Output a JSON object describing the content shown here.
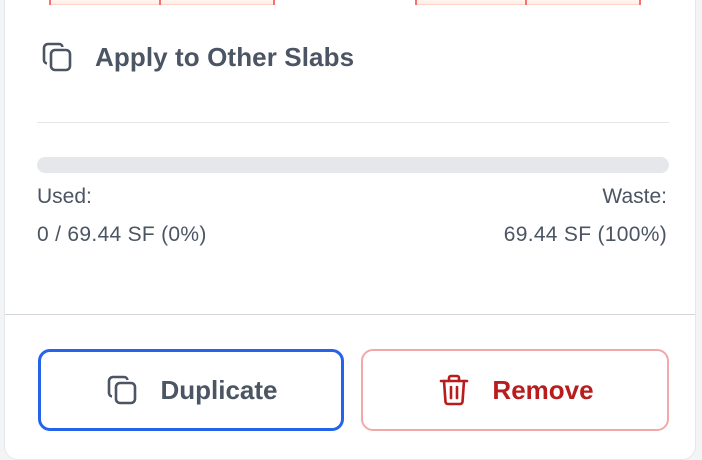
{
  "apply": {
    "label": "Apply to Other Slabs",
    "icon": "copy-icon"
  },
  "usage": {
    "used_label": "Used:",
    "used_value": "0 / 69.44 SF (0%)",
    "waste_label": "Waste:",
    "waste_value": "69.44 SF (100%)",
    "used_fraction": 0
  },
  "actions": {
    "duplicate_label": "Duplicate",
    "duplicate_icon": "copy-icon",
    "remove_label": "Remove",
    "remove_icon": "trash-icon"
  },
  "colors": {
    "accent": "#2563eb",
    "danger": "#b91c1c",
    "danger_border": "#f2a8a8",
    "text_muted": "#4b5563",
    "track": "#e5e7eb"
  }
}
